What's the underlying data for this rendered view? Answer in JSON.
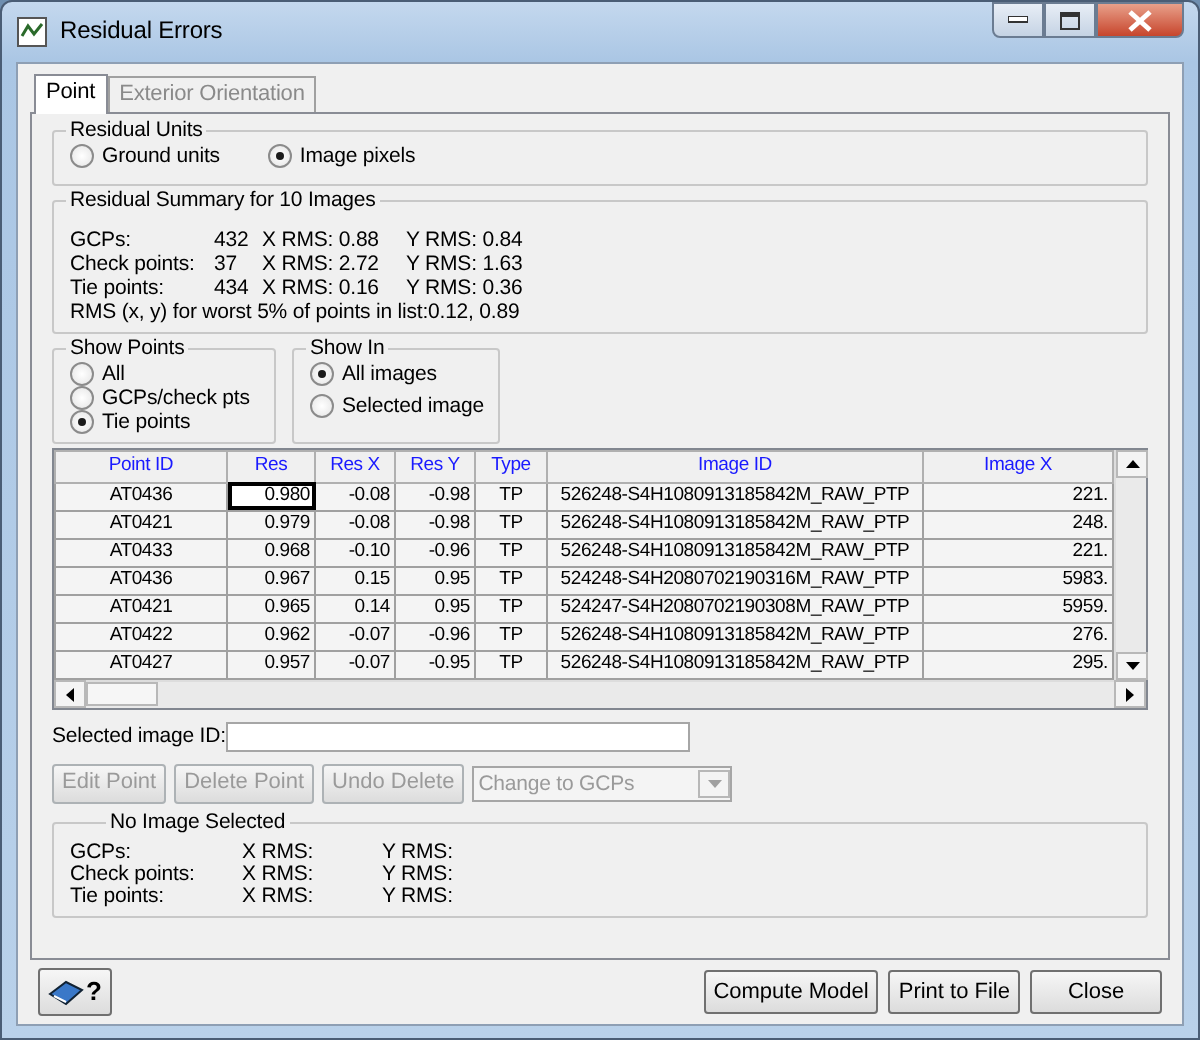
{
  "window": {
    "title": "Residual Errors"
  },
  "tabs": [
    {
      "label": "Point",
      "selected": true,
      "disabled": false
    },
    {
      "label": "Exterior Orientation",
      "selected": false,
      "disabled": true
    }
  ],
  "residual_units": {
    "title": "Residual Units",
    "options": [
      {
        "label": "Ground units",
        "selected": false
      },
      {
        "label": "Image pixels",
        "selected": true
      }
    ]
  },
  "summary": {
    "title": "Residual Summary for 10 Images",
    "rows": [
      {
        "label": "GCPs:",
        "count": "432",
        "x_rms": "X RMS: 0.88",
        "y_rms": "Y RMS: 0.84"
      },
      {
        "label": "Check points:",
        "count": "37",
        "x_rms": "X RMS: 2.72",
        "y_rms": "Y RMS: 1.63"
      },
      {
        "label": "Tie points:",
        "count": "434",
        "x_rms": "X RMS: 0.16",
        "y_rms": "Y RMS: 0.36"
      }
    ],
    "worst": "RMS (x, y) for worst 5% of points in list:0.12, 0.89"
  },
  "show_points": {
    "title": "Show Points",
    "options": [
      {
        "label": "All",
        "selected": false
      },
      {
        "label": "GCPs/check pts",
        "selected": false
      },
      {
        "label": "Tie points",
        "selected": true
      }
    ]
  },
  "show_in": {
    "title": "Show In",
    "options": [
      {
        "label": "All images",
        "selected": true
      },
      {
        "label": "Selected image",
        "selected": false
      }
    ]
  },
  "table": {
    "columns": [
      {
        "label": "Point ID",
        "kind": "text"
      },
      {
        "label": "Res",
        "kind": "number"
      },
      {
        "label": "Res X",
        "kind": "number"
      },
      {
        "label": "Res Y",
        "kind": "number"
      },
      {
        "label": "Type",
        "kind": "text"
      },
      {
        "label": "Image ID",
        "kind": "text"
      },
      {
        "label": "Image X",
        "kind": "number"
      }
    ],
    "rows": [
      {
        "cells": [
          "AT0436",
          "0.980",
          "-0.08",
          "-0.98",
          "TP",
          "526248-S4H1080913185842M_RAW_PTP",
          "221."
        ],
        "focused": true
      },
      {
        "cells": [
          "AT0421",
          "0.979",
          "-0.08",
          "-0.98",
          "TP",
          "526248-S4H1080913185842M_RAW_PTP",
          "248."
        ],
        "focused": false
      },
      {
        "cells": [
          "AT0433",
          "0.968",
          "-0.10",
          "-0.96",
          "TP",
          "526248-S4H1080913185842M_RAW_PTP",
          "221."
        ],
        "focused": false
      },
      {
        "cells": [
          "AT0436",
          "0.967",
          "0.15",
          "0.95",
          "TP",
          "524248-S4H2080702190316M_RAW_PTP",
          "5983."
        ],
        "focused": false
      },
      {
        "cells": [
          "AT0421",
          "0.965",
          "0.14",
          "0.95",
          "TP",
          "524247-S4H2080702190308M_RAW_PTP",
          "5959."
        ],
        "focused": false
      },
      {
        "cells": [
          "AT0422",
          "0.962",
          "-0.07",
          "-0.96",
          "TP",
          "526248-S4H1080913185842M_RAW_PTP",
          "276."
        ],
        "focused": false
      },
      {
        "cells": [
          "AT0427",
          "0.957",
          "-0.07",
          "-0.95",
          "TP",
          "526248-S4H1080913185842M_RAW_PTP",
          "295."
        ],
        "focused": false
      }
    ]
  },
  "selected_image": {
    "label": "Selected image ID:"
  },
  "actions": [
    {
      "label": "Edit Point",
      "disabled": true
    },
    {
      "label": "Delete Point",
      "disabled": true
    },
    {
      "label": "Undo Delete",
      "disabled": true
    }
  ],
  "change_dropdown": {
    "value": "Change to GCPs",
    "disabled": true
  },
  "image_summary": {
    "title": "No Image Selected",
    "rows": [
      {
        "label": "GCPs:",
        "x_rms": "X RMS:",
        "y_rms": "Y RMS:"
      },
      {
        "label": "Check points:",
        "x_rms": "X RMS:",
        "y_rms": "Y RMS:"
      },
      {
        "label": "Tie points:",
        "x_rms": "X RMS:",
        "y_rms": "Y RMS:"
      }
    ]
  },
  "help_button": {
    "label": "?"
  },
  "footer_buttons": [
    "Compute Model",
    "Print to File",
    "Close"
  ]
}
